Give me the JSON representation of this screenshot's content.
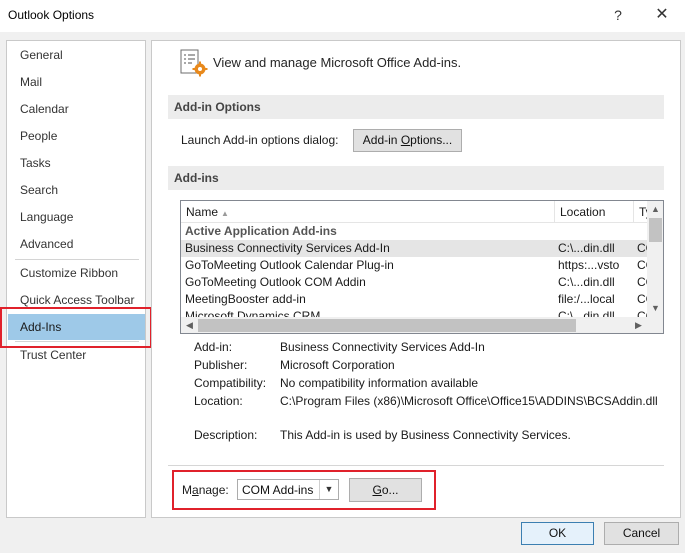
{
  "window": {
    "title": "Outlook Options",
    "help": "?",
    "close": "✕"
  },
  "nav": {
    "items": [
      {
        "label": "General"
      },
      {
        "label": "Mail"
      },
      {
        "label": "Calendar"
      },
      {
        "label": "People"
      },
      {
        "label": "Tasks"
      },
      {
        "label": "Search"
      },
      {
        "label": "Language"
      },
      {
        "label": "Advanced"
      },
      {
        "label": "Customize Ribbon"
      },
      {
        "label": "Quick Access Toolbar"
      },
      {
        "label": "Add-Ins"
      },
      {
        "label": "Trust Center"
      }
    ],
    "selected": "Add-Ins"
  },
  "main": {
    "header": "View and manage Microsoft Office Add-ins.",
    "addin_options_section": "Add-in Options",
    "launch_label": "Launch Add-in options dialog:",
    "addin_options_button": {
      "prefix": "Add-in ",
      "underlined": "O",
      "suffix": "ptions..."
    },
    "addins_section": "Add-ins",
    "list": {
      "columns": [
        "Name",
        "Location",
        "Ty"
      ],
      "sort_indicator": "▲",
      "group": "Active Application Add-ins",
      "rows": [
        {
          "name": "Business Connectivity Services Add-In",
          "location": "C:\\...din.dll",
          "type": "CC",
          "selected": true
        },
        {
          "name": "GoToMeeting Outlook Calendar Plug-in",
          "location": "https:...vsto",
          "type": "CC",
          "selected": false
        },
        {
          "name": "GoToMeeting Outlook COM Addin",
          "location": "C:\\...din.dll",
          "type": "CC",
          "selected": false
        },
        {
          "name": "MeetingBooster add-in",
          "location": "file:/...local",
          "type": "CC",
          "selected": false
        },
        {
          "name": "Microsoft Dynamics CRM",
          "location": "C:\\...din.dll",
          "type": "CC",
          "selected": false
        }
      ]
    },
    "details": {
      "addin_label": "Add-in:",
      "addin_value": "Business Connectivity Services Add-In",
      "publisher_label": "Publisher:",
      "publisher_value": "Microsoft Corporation",
      "compat_label": "Compatibility:",
      "compat_value": "No compatibility information available",
      "location_label": "Location:",
      "location_value": "C:\\Program Files (x86)\\Microsoft Office\\Office15\\ADDINS\\BCSAddin.dll",
      "description_label": "Description:",
      "description_value": "This Add-in is used by Business Connectivity Services."
    },
    "manage": {
      "label_prefix": "M",
      "label_underlined": "a",
      "label_suffix": "nage:",
      "selected": "COM Add-ins",
      "go_underlined": "G",
      "go_suffix": "o..."
    }
  },
  "footer": {
    "ok": "OK",
    "cancel": "Cancel"
  },
  "colors": {
    "selection": "#9ec9e8",
    "highlight_outline": "#e0212b"
  }
}
